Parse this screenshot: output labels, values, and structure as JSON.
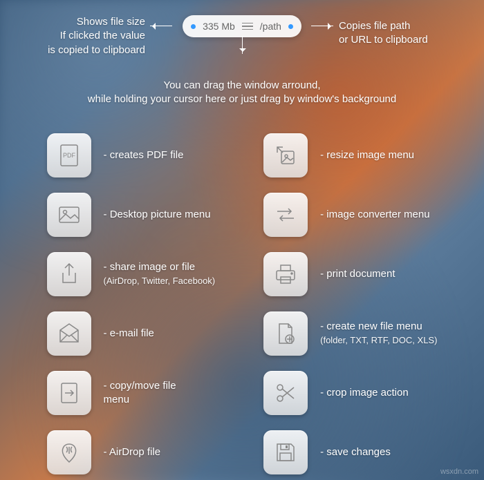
{
  "header": {
    "left_text_l1": "Shows file size",
    "left_text_l2": "If clicked the value",
    "left_text_l3": "is copied to clipboard",
    "right_text_l1": "Copies file path",
    "right_text_l2": "or URL to clipboard",
    "pill_size": "335 Mb",
    "pill_path": "/path",
    "drag_l1": "You can drag the window arround,",
    "drag_l2": "while holding your cursor here or just drag by window's background"
  },
  "left_col": [
    {
      "name": "pdf-icon",
      "label": "- creates PDF file"
    },
    {
      "name": "picture-icon",
      "label": "- Desktop picture menu"
    },
    {
      "name": "share-icon",
      "label": "- share image or file",
      "sub": "(AirDrop, Twitter, Facebook)"
    },
    {
      "name": "mail-icon",
      "label": "- e-mail file"
    },
    {
      "name": "move-icon",
      "label": "- copy/move file\n      menu"
    },
    {
      "name": "airdrop-icon",
      "label": "- AirDrop file"
    }
  ],
  "right_col": [
    {
      "name": "resize-icon",
      "label": "- resize image menu"
    },
    {
      "name": "convert-icon",
      "label": "- image converter menu"
    },
    {
      "name": "print-icon",
      "label": "- print document"
    },
    {
      "name": "newfile-icon",
      "label": "- create new file menu",
      "sub": "(folder, TXT, RTF, DOC, XLS)"
    },
    {
      "name": "crop-icon",
      "label": "- crop image action"
    },
    {
      "name": "save-icon",
      "label": "- save changes"
    }
  ],
  "watermark": "wsxdn.com"
}
